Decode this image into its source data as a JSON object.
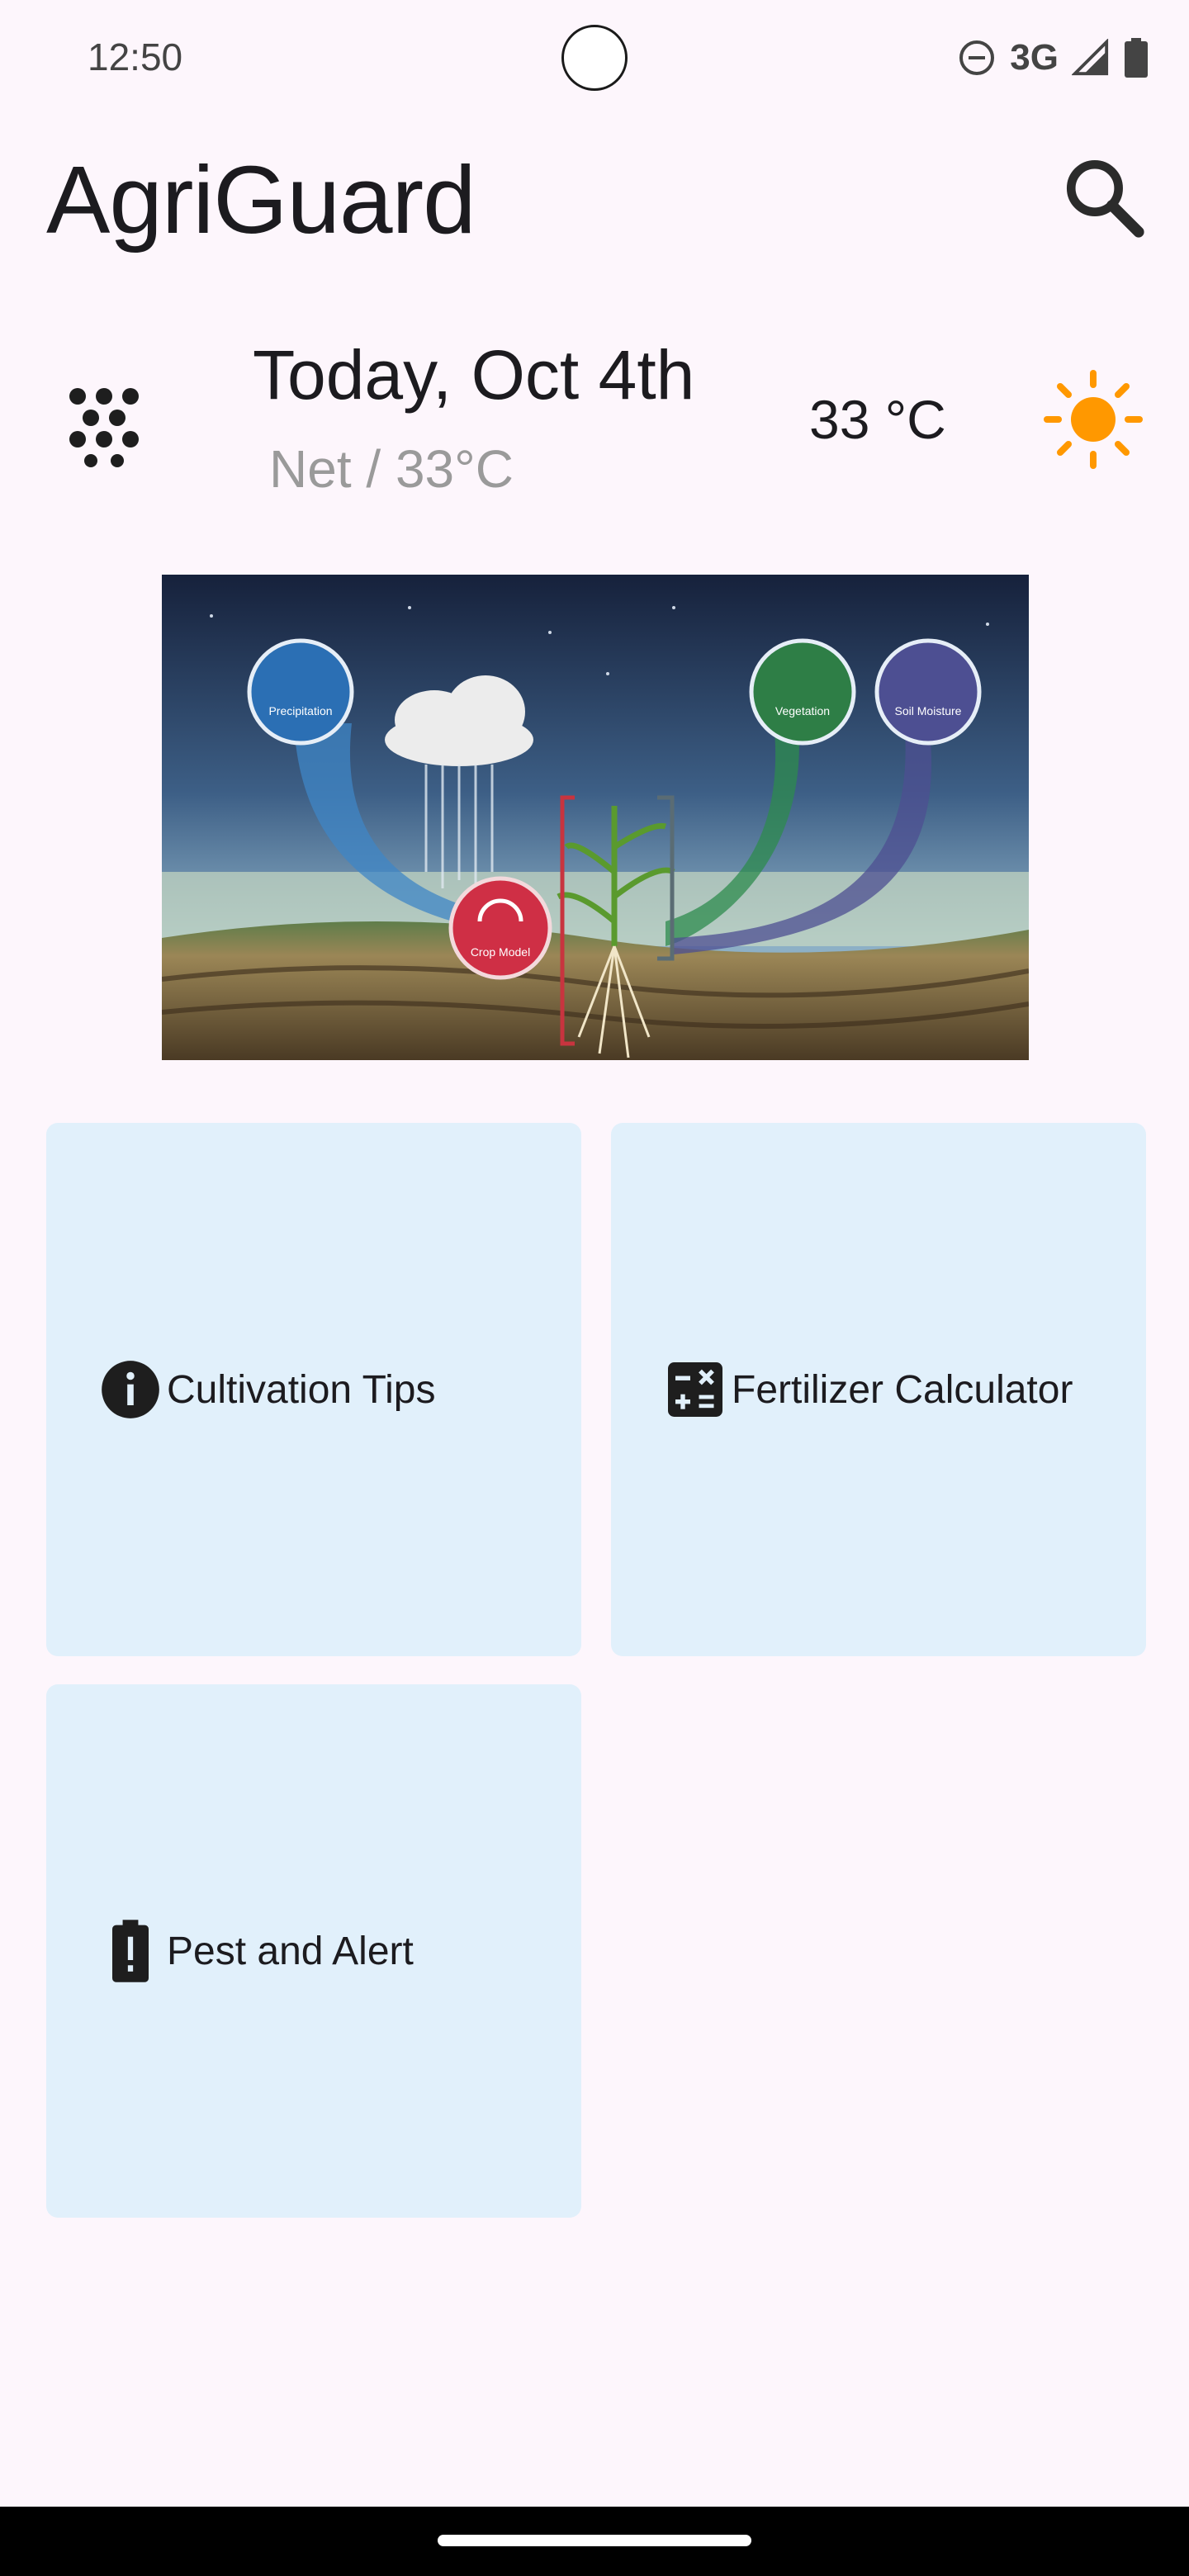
{
  "status_bar": {
    "time": "12:50",
    "network": "3G",
    "icons": [
      "do-not-disturb-icon",
      "signal-icon",
      "battery-icon"
    ]
  },
  "app_bar": {
    "title": "AgriGuard",
    "search_icon": "search-icon"
  },
  "weather": {
    "date": "Today, Oct 4th",
    "subtitle": "Net / 33°C",
    "temperature": "33 °C",
    "condition_icon": "sun-icon",
    "sun_color": "#FF9800"
  },
  "hero": {
    "image_labels": [
      "Precipitation",
      "Vegetation",
      "Soil Moisture",
      "Crop Model"
    ]
  },
  "cards": [
    {
      "label": "Cultivation Tips",
      "icon": "info-icon"
    },
    {
      "label": "Fertilizer Calculator",
      "icon": "calculator-icon"
    },
    {
      "label": "Pest and Alert",
      "icon": "battery-alert-icon"
    }
  ],
  "colors": {
    "background": "#FDF6FC",
    "card_background": "#E1F0FB"
  }
}
